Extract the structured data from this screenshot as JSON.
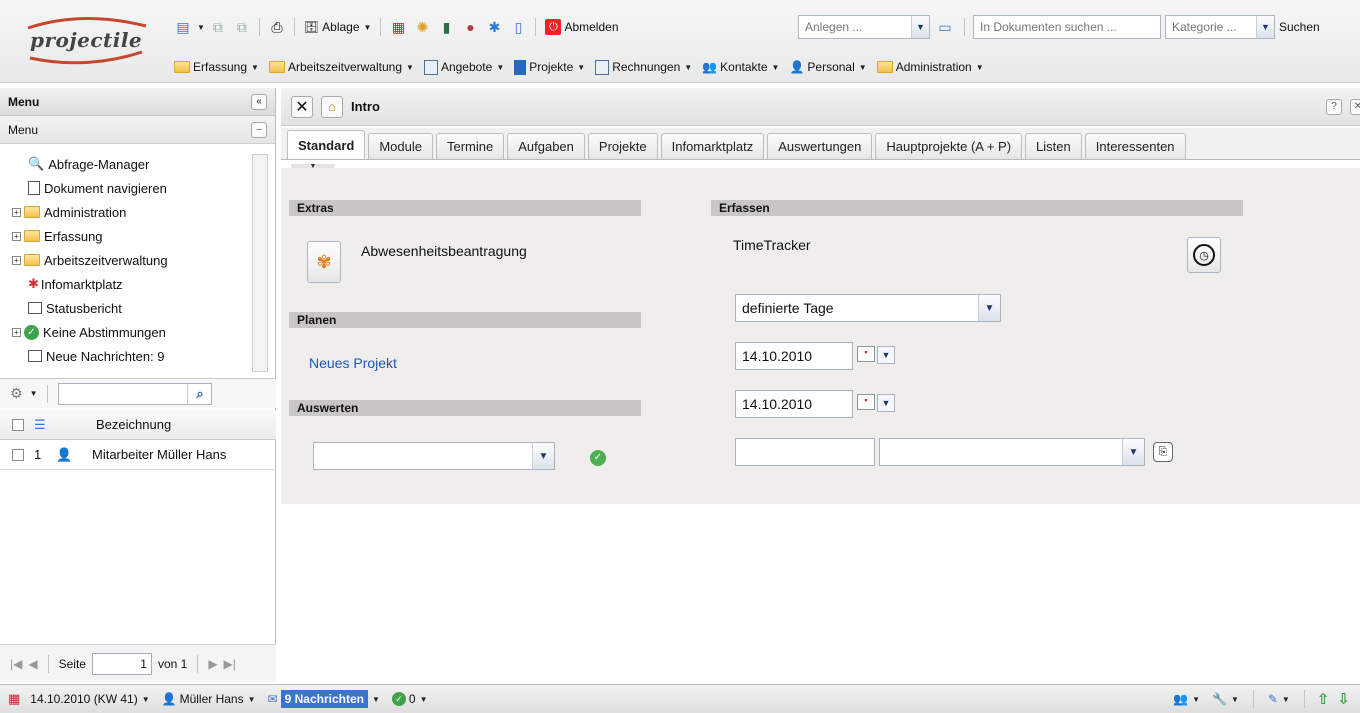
{
  "logo": {
    "text": "projectile"
  },
  "toolbar": {
    "ablage": "Ablage",
    "abmelden": "Abmelden",
    "anlegen_placeholder": "Anlegen ...",
    "doc_search_placeholder": "In Dokumenten suchen ...",
    "kategorie_placeholder": "Kategorie ...",
    "suchen": "Suchen"
  },
  "menubar": {
    "items": [
      "Erfassung",
      "Arbeitszeitverwaltung",
      "Angebote",
      "Projekte",
      "Rechnungen",
      "Kontakte",
      "Personal",
      "Administration"
    ]
  },
  "left": {
    "panel_title": "Menu",
    "sub_title": "Menu",
    "tree": [
      "Abfrage-Manager",
      "Dokument navigieren",
      "Administration",
      "Erfassung",
      "Arbeitszeitverwaltung",
      "Infomarktplatz",
      "Statusbericht",
      "Keine Abstimmungen",
      "Neue Nachrichten: 9"
    ],
    "grid": {
      "header": "Bezeichnung",
      "rows": [
        {
          "num": "1",
          "label": "Mitarbeiter Müller Hans"
        }
      ]
    },
    "pager": {
      "seite": "Seite",
      "value": "1",
      "von": "von 1"
    }
  },
  "main": {
    "title": "Intro",
    "tabs": [
      "Standard",
      "Module",
      "Termine",
      "Aufgaben",
      "Projekte",
      "Infomarktplatz",
      "Auswertungen",
      "Hauptprojekte (A + P)",
      "Listen",
      "Interessenten"
    ],
    "sections": {
      "extras": "Extras",
      "erfassen": "Erfassen",
      "planen": "Planen",
      "auswerten": "Auswerten"
    },
    "abwesenheit": "Abwesenheitsbeantragung",
    "timetracker": "TimeTracker",
    "neues_projekt": "Neues Projekt",
    "period_select": "definierte Tage",
    "date_from": "14.10.2010",
    "date_to": "14.10.2010"
  },
  "status": {
    "date": "14.10.2010 (KW 41)",
    "user": "Müller Hans",
    "messages": "9 Nachrichten",
    "count": "0"
  },
  "colors": {
    "accent": "#3b73d3",
    "link": "#1f57b5",
    "section": "#c9c6c6",
    "content_bg": "#f0eded"
  }
}
